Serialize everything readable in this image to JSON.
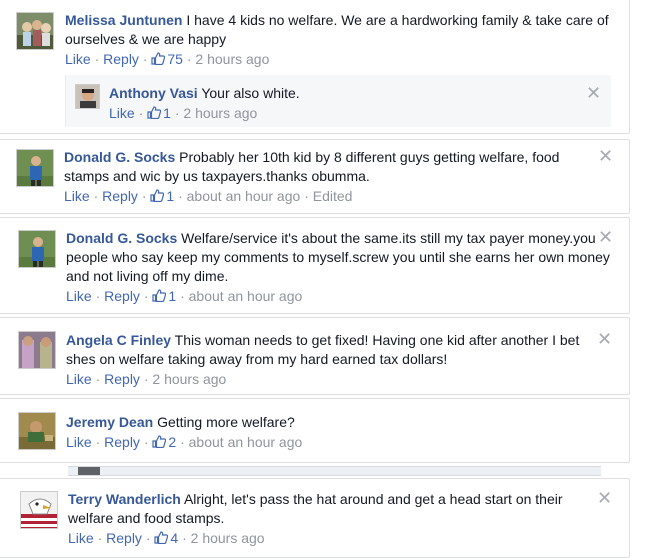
{
  "comments": [
    {
      "name": "Melissa Juntunen",
      "text": "I have 4 kids no welfare. We are a hardworking family & take care of ourselves & we are happy",
      "like": "Like",
      "reply": "Reply",
      "likes": "75",
      "time": "2 hours ago",
      "replies": [
        {
          "name": "Anthony Vasi",
          "text": "Your also white.",
          "like": "Like",
          "likes": "1",
          "time": "2 hours ago"
        }
      ]
    },
    {
      "name": "Donald G. Socks",
      "text": "Probably her 10th kid by 8 different guys getting welfare, food stamps and wic by us taxpayers.thanks obumma.",
      "like": "Like",
      "reply": "Reply",
      "likes": "1",
      "time": "about an hour ago",
      "edited": "Edited"
    },
    {
      "name": "Donald G. Socks",
      "text": "Welfare/service it's about the same.its still my tax payer money.you people who say keep my comments to myself.screw you until she earns her own money and not living off my dime.",
      "like": "Like",
      "reply": "Reply",
      "likes": "1",
      "time": "about an hour ago"
    },
    {
      "name": "Angela C Finley",
      "text": "This woman needs to get fixed! Having one kid after another I bet shes on welfare taking away from my hard earned tax dollars!",
      "like": "Like",
      "reply": "Reply",
      "time": "2 hours ago"
    },
    {
      "name": "Jeremy Dean",
      "text": "Getting more welfare?",
      "like": "Like",
      "reply": "Reply",
      "likes": "2",
      "time": "about an hour ago"
    },
    {
      "name": "Terry Wanderlich",
      "text": "Alright, let's pass the hat around and get a head start on their welfare and food stamps.",
      "like": "Like",
      "reply": "Reply",
      "likes": "4",
      "time": "2 hours ago"
    }
  ],
  "close_glyph": "✕",
  "sep": "·",
  "colors": {
    "link": "#365899",
    "meta": "#90949c",
    "action": "#4267b2"
  }
}
